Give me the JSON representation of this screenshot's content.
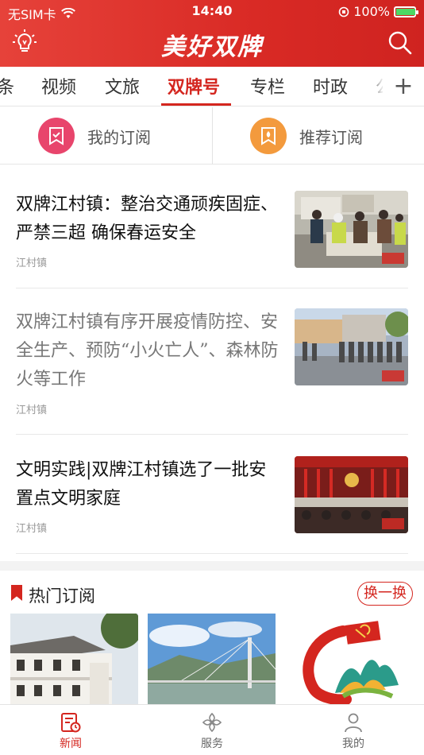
{
  "status_bar": {
    "carrier": "无SIM卡",
    "time": "14:40",
    "battery": "100%"
  },
  "app_bar": {
    "logo": "美好双牌",
    "left_icon": "lightbulb-icon",
    "right_icon": "search-icon"
  },
  "channels": {
    "tabs": [
      {
        "label": "条"
      },
      {
        "label": "视频"
      },
      {
        "label": "文旅"
      },
      {
        "label": "双牌号",
        "active": true
      },
      {
        "label": "专栏"
      },
      {
        "label": "时政"
      },
      {
        "label": "公"
      }
    ],
    "add_label": "+"
  },
  "subscribe": {
    "mine_label": "我的订阅",
    "recommend_label": "推荐订阅"
  },
  "news": [
    {
      "title": "双牌江村镇：整治交通顽疾固症、严禁三超 确保春运安全",
      "source": "江村镇",
      "read": false
    },
    {
      "title": "双牌江村镇有序开展疫情防控、安全生产、预防“小火亡人”、森林防火等工作",
      "source": "江村镇",
      "read": true
    },
    {
      "title": "文明实践|双牌江村镇选了一批安置点文明家庭",
      "source": "江村镇",
      "read": false
    }
  ],
  "hot": {
    "title": "热门订阅",
    "refresh_label": "换一换"
  },
  "bottom_nav": {
    "items": [
      {
        "label": "新闻",
        "icon": "news-icon",
        "active": true
      },
      {
        "label": "服务",
        "icon": "services-icon"
      },
      {
        "label": "我的",
        "icon": "profile-icon"
      }
    ]
  },
  "colors": {
    "brand": "#d4261f",
    "header_bg": "#e0342e",
    "accent_pink": "#e8456c",
    "accent_orange": "#f39a3d"
  }
}
